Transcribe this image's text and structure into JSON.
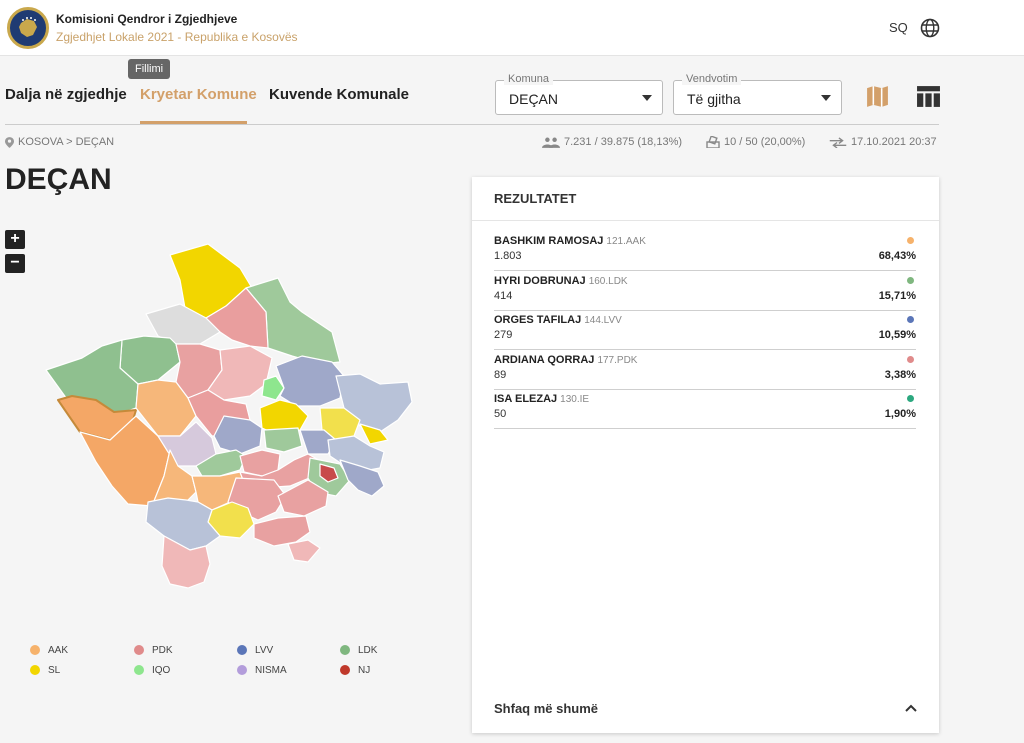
{
  "header": {
    "org_name": "Komisioni Qendror i Zgjedhjeve",
    "subtitle": "Zgjedhjet Lokale 2021 - Republika e Kosovës",
    "language": "SQ"
  },
  "tabs": {
    "items": [
      {
        "label": "Dalja në zgjedhje"
      },
      {
        "label": "Kryetar Komune"
      },
      {
        "label": "Kuvende Komunale"
      }
    ],
    "tooltip": "Fillimi"
  },
  "filters": {
    "komuna": {
      "label": "Komuna",
      "value": "DEÇAN"
    },
    "vendvotim": {
      "label": "Vendvotim",
      "value": "Të gjitha"
    }
  },
  "breadcrumb": {
    "root": "KOSOVA",
    "sep": ">",
    "current": "DEÇAN"
  },
  "stats": {
    "turnout": "7.231 / 39.875 (18,13%)",
    "stations": "10 / 50 (20,00%)",
    "updated": "17.10.2021 20:37"
  },
  "page_title": "DEÇAN",
  "zoom": {
    "in": "+",
    "out": "−"
  },
  "legend": [
    {
      "label": "AAK",
      "color": "#f6b26b"
    },
    {
      "label": "PDK",
      "color": "#e08b8b"
    },
    {
      "label": "LVV",
      "color": "#5b76b8"
    },
    {
      "label": "LDK",
      "color": "#7fb77f"
    },
    {
      "label": "SL",
      "color": "#f2d600"
    },
    {
      "label": "IQO",
      "color": "#8ee68e"
    },
    {
      "label": "NISMA",
      "color": "#b39ddb"
    },
    {
      "label": "NJ",
      "color": "#c0392b"
    }
  ],
  "results": {
    "title": "REZULTATET",
    "rows": [
      {
        "name": "BASHKIM RAMOSAJ",
        "code": "121.AAK",
        "votes": "1.803",
        "pct": "68,43%",
        "color": "#f6b26b"
      },
      {
        "name": "HYRI DOBRUNAJ",
        "code": "160.LDK",
        "votes": "414",
        "pct": "15,71%",
        "color": "#7fb77f"
      },
      {
        "name": "ORGES TAFILAJ",
        "code": "144.LVV",
        "votes": "279",
        "pct": "10,59%",
        "color": "#5b76b8"
      },
      {
        "name": "ARDIANA QORRAJ",
        "code": "177.PDK",
        "votes": "89",
        "pct": "3,38%",
        "color": "#e08b8b"
      },
      {
        "name": "ISA ELEZAJ",
        "code": "130.IE",
        "votes": "50",
        "pct": "1,90%",
        "color": "#2ca87f"
      }
    ],
    "show_more": "Shfaq më shumë"
  }
}
